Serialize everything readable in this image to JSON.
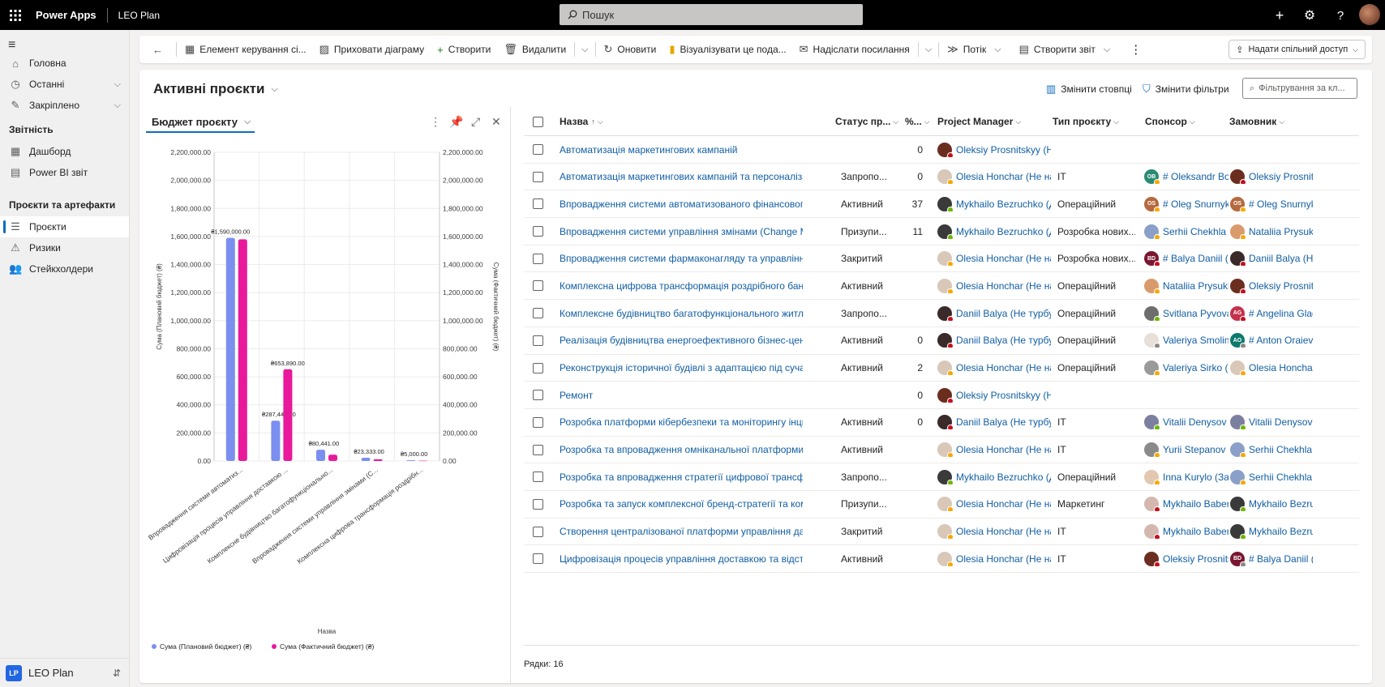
{
  "top": {
    "product": "Power Apps",
    "app": "LEO Plan",
    "search_placeholder": "Пошук"
  },
  "nav": {
    "items_top": [
      {
        "label": "Головна",
        "icon": "home-icon",
        "glyph": "⌂"
      },
      {
        "label": "Останні",
        "icon": "clock-icon",
        "glyph": "◷",
        "chevron": true
      },
      {
        "label": "Закріплено",
        "icon": "pin-icon",
        "glyph": "✎",
        "chevron": true
      }
    ],
    "section_reports": "Звітність",
    "reports": [
      {
        "label": "Дашборд",
        "icon": "dashboard-icon",
        "glyph": "▦"
      },
      {
        "label": "Power BI звіт",
        "icon": "report-icon",
        "glyph": "▤"
      }
    ],
    "section_projects": "Проєкти та артефакти",
    "projects": [
      {
        "label": "Проєкти",
        "icon": "projects-icon",
        "glyph": "☰",
        "active": true
      },
      {
        "label": "Ризики",
        "icon": "warning-icon",
        "glyph": "⚠"
      },
      {
        "label": "Стейкхолдери",
        "icon": "people-icon",
        "glyph": "👥"
      }
    ],
    "area_badge": "LP",
    "area_name": "LEO Plan"
  },
  "commands": [
    {
      "label": "Елемент керування сі...",
      "icon": "grid-control-icon",
      "glyph": "▦"
    },
    {
      "label": "Приховати діаграму",
      "icon": "chart-icon",
      "glyph": "▨"
    },
    {
      "label": "Створити",
      "icon": "add-icon",
      "glyph": "+"
    },
    {
      "label": "Видалити",
      "icon": "delete-icon",
      "glyph": "🗑"
    },
    {
      "label": "Оновити",
      "icon": "refresh-icon",
      "glyph": "↻"
    },
    {
      "label": "Візуалізувати це пода...",
      "icon": "powerbi-icon",
      "glyph": "▮"
    },
    {
      "label": "Надіслати посилання",
      "icon": "mail-icon",
      "glyph": "✉"
    },
    {
      "label": "Потік",
      "icon": "flow-icon",
      "glyph": "≫"
    },
    {
      "label": "Створити звіт",
      "icon": "report-icon",
      "glyph": "▤"
    }
  ],
  "share_label": "Надати спільний доступ",
  "view": {
    "title": "Активні проєкти",
    "edit_columns": "Змінити стовпці",
    "edit_filters": "Змінити фільтри",
    "filter_placeholder": "Фільтрування за кл..."
  },
  "chart": {
    "selector": "Бюджет проєкту"
  },
  "chart_data": {
    "type": "bar",
    "categories": [
      "Впровадження системи автоматиз...",
      "Цифровізація процесів управління доставкою ...",
      "Комплексне будівництво багатофункціонально...",
      "Впровадження системи управління змінами (C...",
      "Комплексна цифрова трансформація роздрібн..."
    ],
    "series": [
      {
        "name": "Сума (Плановий бюджет) (₴)",
        "color": "#7b8ff0",
        "values": [
          1590000,
          287445,
          80441,
          23333,
          5000
        ],
        "labels": [
          "₴1,590,000.00",
          "₴287,445.00",
          "₴80,441.00",
          "₴23,333.00",
          "₴5,000.00"
        ]
      },
      {
        "name": "Сума (Фактичний бюджет) (₴)",
        "color": "#e8199b",
        "values": [
          1580000,
          653890,
          45000,
          12000,
          2000
        ],
        "labels": [
          "",
          "₴653,890.00",
          "",
          "",
          ""
        ]
      }
    ],
    "yticks": [
      "0.00",
      "200,000.00",
      "400,000.00",
      "600,000.00",
      "800,000.00",
      "1,000,000.00",
      "1,200,000.00",
      "1,400,000.00",
      "1,600,000.00",
      "1,800,000.00",
      "2,000,000.00",
      "2,200,000.00"
    ],
    "ylim": [
      0,
      2200000
    ],
    "ylabel": "Сума (Плановий бюджет) (₴)",
    "y2label": "Сума (Фактичний бюджет) (₴)",
    "xlabel": "Назва",
    "legend_position": "bottom-left"
  },
  "grid": {
    "columns": [
      "Назва",
      "Статус пр...",
      "%...",
      "Project Manager",
      "Тип проєкту",
      "Спонсор",
      "Замовник"
    ],
    "rows": [
      {
        "name": "Автоматизація маркетингових кампаній",
        "status": "",
        "pct": "0",
        "pm": {
          "t": "Oleksiy Prosnitskyy (Не...",
          "c": "#6b2e1e",
          "ini": "",
          "d": "#c50f1f"
        },
        "type": "",
        "sp": null,
        "cu": null
      },
      {
        "name": "Автоматизація маркетингових кампаній та персоналізація к...",
        "status": "Запропо...",
        "pct": "0",
        "pm": {
          "t": "Olesia Honchar (Не на ...",
          "c": "#d9c7b8",
          "ini": "",
          "d": "#f7a800"
        },
        "type": "IT",
        "sp": {
          "t": "# Oleksandr Bor...",
          "c": "#2a8a74",
          "ini": "OB",
          "d": "#f7a800"
        },
        "cu": {
          "t": "Oleksiy Prosnits...",
          "c": "#6b2e1e",
          "ini": "",
          "d": "#c50f1f"
        }
      },
      {
        "name": "Впровадження системи автоматизованого фінансового мон...",
        "status": "Активний",
        "pct": "37",
        "pm": {
          "t": "Mykhailo Bezruchko (Д...",
          "c": "#3a3a3a",
          "ini": "",
          "d": "#6bb700"
        },
        "type": "Операційний",
        "sp": {
          "t": "# Oleg Snurnyk...",
          "c": "#b5693e",
          "ini": "OS",
          "d": "#f7a800"
        },
        "cu": {
          "t": "# Oleg Snurnyk...",
          "c": "#b5693e",
          "ini": "OS",
          "d": "#f7a800"
        }
      },
      {
        "name": "Впровадження системи управління змінами (Change Manag...",
        "status": "Призупи...",
        "pct": "11",
        "pm": {
          "t": "Mykhailo Bezruchko (Д...",
          "c": "#3a3a3a",
          "ini": "",
          "d": "#6bb700"
        },
        "type": "Розробка нових...",
        "sp": {
          "t": "Serhii Chekhla (...",
          "c": "#8aa0c8",
          "ini": "",
          "d": "#f7a800"
        },
        "cu": {
          "t": "Nataliia Prysukh...",
          "c": "#d99a6c",
          "ini": "",
          "d": "#f7a800"
        }
      },
      {
        "name": "Впровадження системи фармаконагляду та управління побі...",
        "status": "Закритий",
        "pct": "",
        "pm": {
          "t": "Olesia Honchar (Не на ...",
          "c": "#d9c7b8",
          "ini": "",
          "d": "#f7a800"
        },
        "type": "Розробка нових...",
        "sp": {
          "t": "# Balya Daniil (...",
          "c": "#7a1730",
          "ini": "BD",
          "d": "#c50f1f"
        },
        "cu": {
          "t": "Daniil Balya (Не ...",
          "c": "#3a2a2a",
          "ini": "",
          "d": "#c50f1f"
        }
      },
      {
        "name": "Комплексна цифрова трансформація роздрібного банкінгу ...",
        "status": "Активний",
        "pct": "",
        "pm": {
          "t": "Olesia Honchar (Не на ...",
          "c": "#d9c7b8",
          "ini": "",
          "d": "#f7a800"
        },
        "type": "Операційний",
        "sp": {
          "t": "Nataliia Prysukh...",
          "c": "#d99a6c",
          "ini": "",
          "d": "#f7a800"
        },
        "cu": {
          "t": "Oleksiy Prosnits...",
          "c": "#6b2e1e",
          "ini": "",
          "d": "#c50f1f"
        }
      },
      {
        "name": "Комплексне будівництво багатофункціонального житлового...",
        "status": "Запропо...",
        "pct": "",
        "pm": {
          "t": "Daniil Balya (Не турбув...",
          "c": "#3a2a2a",
          "ini": "",
          "d": "#c50f1f"
        },
        "type": "Операційний",
        "sp": {
          "t": "Svitlana Pyvovar...",
          "c": "#6d6d6d",
          "ini": "",
          "d": "#6bb700"
        },
        "cu": {
          "t": "# Angelina Glad...",
          "c": "#c4314b",
          "ini": "AG",
          "d": "#c50f1f"
        }
      },
      {
        "name": "Реалізація будівництва енергоефективного бізнес-центру к...",
        "status": "Активний",
        "pct": "0",
        "pm": {
          "t": "Daniil Balya (Не турбув...",
          "c": "#3a2a2a",
          "ini": "",
          "d": "#c50f1f"
        },
        "type": "Операційний",
        "sp": {
          "t": "Valeriya Smolin...",
          "c": "#e8e0d8",
          "ini": "",
          "d": "#8a8886"
        },
        "cu": {
          "t": "# Anton Oraievs...",
          "c": "#0e7a6e",
          "ini": "AO",
          "d": "#8a8886"
        }
      },
      {
        "name": "Реконструкція історичної будівлі з адаптацією під сучасний ...",
        "status": "Активний",
        "pct": "2",
        "pm": {
          "t": "Olesia Honchar (Не на ...",
          "c": "#d9c7b8",
          "ini": "",
          "d": "#f7a800"
        },
        "type": "Операційний",
        "sp": {
          "t": "Valeriya Sirko (Н...",
          "c": "#9a9a9a",
          "ini": "",
          "d": "#f7a800"
        },
        "cu": {
          "t": "Olesia Honchar ...",
          "c": "#d9c7b8",
          "ini": "",
          "d": "#f7a800"
        }
      },
      {
        "name": "Ремонт",
        "status": "",
        "pct": "0",
        "pm": {
          "t": "Oleksiy Prosnitskyy (Не...",
          "c": "#6b2e1e",
          "ini": "",
          "d": "#c50f1f"
        },
        "type": "",
        "sp": null,
        "cu": null
      },
      {
        "name": "Розробка платформи кібербезпеки та моніторингу інцидент...",
        "status": "Активний",
        "pct": "0",
        "pm": {
          "t": "Daniil Balya (Не турбув...",
          "c": "#3a2a2a",
          "ini": "",
          "d": "#c50f1f"
        },
        "type": "IT",
        "sp": {
          "t": "Vitalii Denysov (...",
          "c": "#7d7fa0",
          "ini": "",
          "d": "#6bb700"
        },
        "cu": {
          "t": "Vitalii Denysov (...",
          "c": "#7d7fa0",
          "ini": "",
          "d": "#6bb700"
        }
      },
      {
        "name": "Розробка та впровадження омніканальної платформи цифр...",
        "status": "Активний",
        "pct": "",
        "pm": {
          "t": "Olesia Honchar (Не на ...",
          "c": "#d9c7b8",
          "ini": "",
          "d": "#f7a800"
        },
        "type": "IT",
        "sp": {
          "t": "Yurii Stepanov (...",
          "c": "#8a8a8a",
          "ini": "",
          "d": "#f7a800"
        },
        "cu": {
          "t": "Serhii Chekhla (...",
          "c": "#8aa0c8",
          "ini": "",
          "d": "#f7a800"
        }
      },
      {
        "name": "Розробка та впровадження стратегії цифрової трансформації",
        "status": "Запропо...",
        "pct": "",
        "pm": {
          "t": "Mykhailo Bezruchko (Д...",
          "c": "#3a3a3a",
          "ini": "",
          "d": "#6bb700"
        },
        "type": "Операційний",
        "sp": {
          "t": "Inna Kurylo (За...",
          "c": "#e2c8b0",
          "ini": "",
          "d": "#f7a800"
        },
        "cu": {
          "t": "Serhii Chekhla (...",
          "c": "#8aa0c8",
          "ini": "",
          "d": "#f7a800"
        }
      },
      {
        "name": "Розробка та запуск комплексної бренд-стратегії та комуніка...",
        "status": "Призупи...",
        "pct": "",
        "pm": {
          "t": "Olesia Honchar (Не на ...",
          "c": "#d9c7b8",
          "ini": "",
          "d": "#f7a800"
        },
        "type": "Маркетинг",
        "sp": {
          "t": "Mykhailo Baben...",
          "c": "#d4b8b0",
          "ini": "",
          "d": "#c50f1f"
        },
        "cu": {
          "t": "Mykhailo Bezru...",
          "c": "#3a3a3a",
          "ini": "",
          "d": "#6bb700"
        }
      },
      {
        "name": "Створення централізованої платформи управління даними (...",
        "status": "Закритий",
        "pct": "",
        "pm": {
          "t": "Olesia Honchar (Не на ...",
          "c": "#d9c7b8",
          "ini": "",
          "d": "#f7a800"
        },
        "type": "IT",
        "sp": {
          "t": "Mykhailo Baben...",
          "c": "#d4b8b0",
          "ini": "",
          "d": "#c50f1f"
        },
        "cu": {
          "t": "Mykhailo Bezru...",
          "c": "#3a3a3a",
          "ini": "",
          "d": "#6bb700"
        }
      },
      {
        "name": "Цифровізація процесів управління доставкою та відстежен...",
        "status": "Активний",
        "pct": "",
        "pm": {
          "t": "Olesia Honchar (Не на ...",
          "c": "#d9c7b8",
          "ini": "",
          "d": "#f7a800"
        },
        "type": "IT",
        "sp": {
          "t": "Oleksiy Prosnits...",
          "c": "#6b2e1e",
          "ini": "",
          "d": "#c50f1f"
        },
        "cu": {
          "t": "# Balya Daniil (...",
          "c": "#7a1730",
          "ini": "BD",
          "d": "#8a8886"
        }
      }
    ],
    "row_count": "Рядки: 16"
  }
}
